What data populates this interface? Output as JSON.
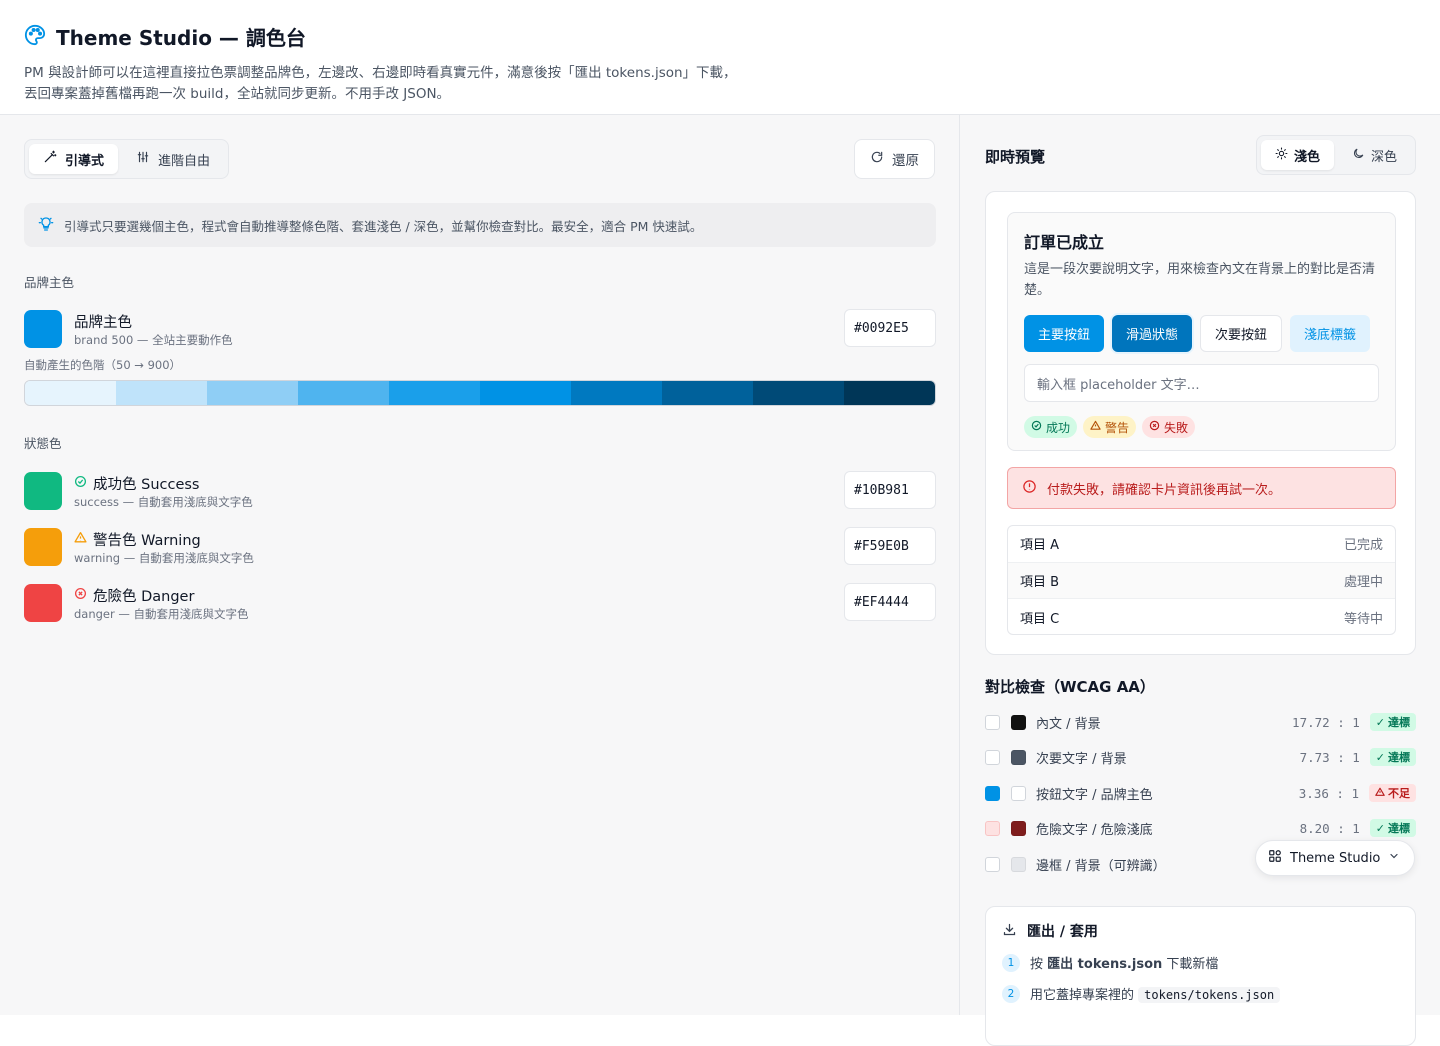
{
  "header": {
    "title": "Theme Studio — 調色台",
    "description": "PM 與設計師可以在這裡直接拉色票調整品牌色，左邊改、右邊即時看真實元件，滿意後按「匯出 tokens.json」下載，丟回專案蓋掉舊檔再跑一次 build，全站就同步更新。不用手改 JSON。"
  },
  "left": {
    "mode_tabs": [
      {
        "label": "引導式",
        "active": true
      },
      {
        "label": "進階自由",
        "active": false
      }
    ],
    "reset_label": "還原",
    "tip": "引導式只要選幾個主色，程式會自動推導整條色階、套進淺色 / 深色，並幫你檢查對比。最安全，適合 PM 快速試。",
    "brand_section_label": "品牌主色",
    "brand": {
      "name": "品牌主色",
      "sub": "brand 500 — 全站主要動作色",
      "hex": "#0092E5",
      "color": "#0092E5"
    },
    "scale_label": "自動產生的色階（50 → 900）",
    "scale_colors": [
      "#e6f4fd",
      "#bfe3fa",
      "#8fcef5",
      "#4fb4ef",
      "#1a9fea",
      "#0092E5",
      "#0079c0",
      "#00619b",
      "#004a77",
      "#003657"
    ],
    "status_section_label": "狀態色",
    "status_colors": [
      {
        "name": "成功色 Success",
        "sub": "success — 自動套用淺底與文字色",
        "hex": "#10B981",
        "color": "#10B981",
        "icon": "check-circle-icon"
      },
      {
        "name": "警告色 Warning",
        "sub": "warning — 自動套用淺底與文字色",
        "hex": "#F59E0B",
        "color": "#F59E0B",
        "icon": "warning-triangle-icon"
      },
      {
        "name": "危險色 Danger",
        "sub": "danger — 自動套用淺底與文字色",
        "hex": "#EF4444",
        "color": "#EF4444",
        "icon": "x-circle-icon"
      }
    ]
  },
  "right": {
    "preview_title": "即時預覽",
    "theme_tabs": [
      {
        "label": "淺色",
        "active": true
      },
      {
        "label": "深色",
        "active": false
      }
    ],
    "order_card": {
      "title": "訂單已成立",
      "desc": "這是一段次要說明文字，用來檢查內文在背景上的對比是否清楚。",
      "buttons": [
        "主要按鈕",
        "滑過狀態",
        "次要按鈕",
        "淺底標籤"
      ],
      "input_placeholder": "輸入框 placeholder 文字…",
      "badges": [
        "成功",
        "警告",
        "失敗"
      ]
    },
    "alert_text": "付款失敗，請確認卡片資訊後再試一次。",
    "items": [
      {
        "name": "項目 A",
        "status": "已完成"
      },
      {
        "name": "項目 B",
        "status": "處理中"
      },
      {
        "name": "項目 C",
        "status": "等待中"
      }
    ],
    "contrast_title": "對比檢查（WCAG AA）",
    "contrast": [
      {
        "label": "內文 / 背景",
        "ratio": "17.72 : 1",
        "result": "達標",
        "pass": true,
        "chip": "#111111",
        "box": ""
      },
      {
        "label": "次要文字 / 背景",
        "ratio": "7.73 : 1",
        "result": "達標",
        "pass": true,
        "chip": "#4b5563",
        "box": ""
      },
      {
        "label": "按鈕文字 / 品牌主色",
        "ratio": "3.36 : 1",
        "result": "不足",
        "pass": false,
        "chip": "#ffffff",
        "box": "checked"
      },
      {
        "label": "危險文字 / 危險淺底",
        "ratio": "8.20 : 1",
        "result": "達標",
        "pass": true,
        "chip": "#7f1d1d",
        "box": "pink"
      },
      {
        "label": "邊框 / 背景（可辨識）",
        "ratio": "",
        "result": "",
        "pass": true,
        "chip": "#e5e7eb",
        "box": ""
      }
    ],
    "studio_chip_label": "Theme Studio",
    "export": {
      "title": "匯出 / 套用",
      "step1_num": "1",
      "step1_pre": "按",
      "step1_bold": "匯出 tokens.json",
      "step1_post": "下載新檔",
      "step2_num": "2",
      "step2_pre": "用它蓋掉專案裡的",
      "step2_code": "tokens/tokens.json"
    }
  }
}
